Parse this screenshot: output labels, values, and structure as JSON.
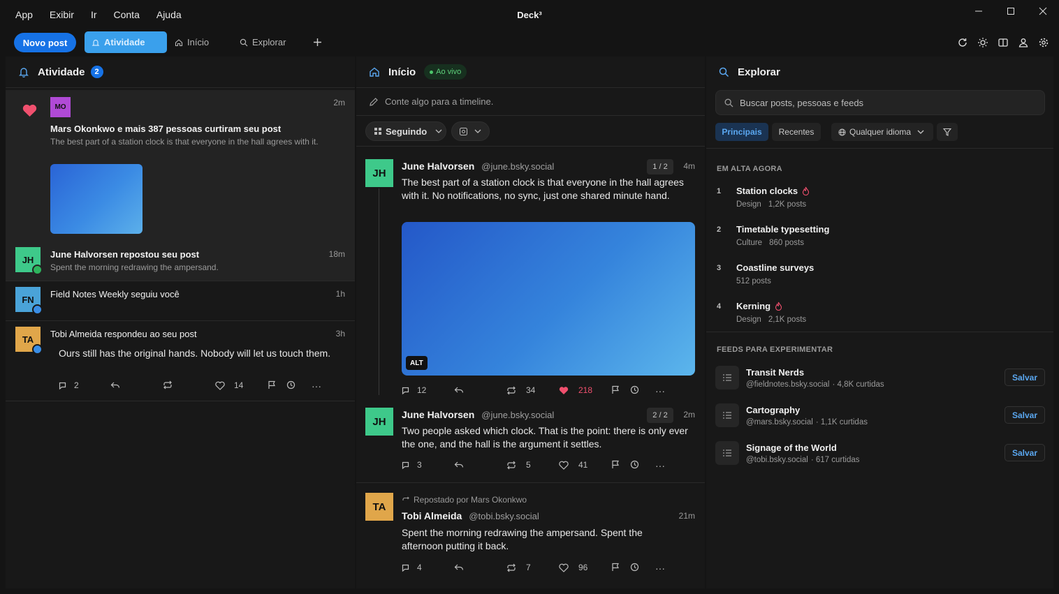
{
  "menu": [
    "App",
    "Exibir",
    "Ir",
    "Conta",
    "Ajuda"
  ],
  "window": {
    "title": "Deck³"
  },
  "toolbar": {
    "new_post": "Novo post",
    "tabs": {
      "activity": "Atividade",
      "home": "Início",
      "explore": "Explorar"
    }
  },
  "activity": {
    "title": "Atividade",
    "badge": "2",
    "items": [
      {
        "avatar": "MO",
        "avatar_color": "#b04ad6",
        "title": "Mars Okonkwo e mais 387 pessoas curtiram seu post",
        "snippet": "The best part of a station clock is that everyone in the hall agrees with it.",
        "time": "2m"
      },
      {
        "avatar": "JH",
        "avatar_color": "#3ec98a",
        "title": "June Halvorsen repostou seu post",
        "snippet": "Spent the morning redrawing the ampersand.",
        "time": "18m"
      },
      {
        "avatar": "FN",
        "avatar_color": "#4aa3d8",
        "title": "Field Notes Weekly seguiu você",
        "time": "1h"
      },
      {
        "avatar": "TA",
        "avatar_color": "#e0a64a",
        "title": "Tobi Almeida respondeu ao seu post",
        "reply": "Ours still has the original hands. Nobody will let us touch them.",
        "time": "3h",
        "replies": "2",
        "likes": "14"
      }
    ]
  },
  "home": {
    "title": "Início",
    "live": "Ao vivo",
    "composer_placeholder": "Conte algo para a timeline.",
    "feed_select": "Seguindo",
    "posts": [
      {
        "avatar": "JH",
        "avatar_color": "#3ec98a",
        "name": "June Halvorsen",
        "handle": "@june.bsky.social",
        "thread": "1 / 2",
        "time": "4m",
        "text": "The best part of a station clock is that everyone in the hall agrees with it. No notifications, no sync, just one shared minute hand.",
        "alt": "ALT",
        "replies": "12",
        "reposts": "34",
        "likes": "218"
      },
      {
        "avatar": "JH",
        "avatar_color": "#3ec98a",
        "name": "June Halvorsen",
        "handle": "@june.bsky.social",
        "thread": "2 / 2",
        "time": "2m",
        "text": "Two people asked which clock. That is the point: there is only ever the one, and the hall is the argument it settles.",
        "replies": "3",
        "reposts": "5",
        "likes": "41"
      },
      {
        "avatar": "TA",
        "avatar_color": "#e0a64a",
        "repost_by": "Repostado por Mars Okonkwo",
        "name": "Tobi Almeida",
        "handle": "@tobi.bsky.social",
        "time": "21m",
        "text": "Spent the morning redrawing the ampersand. Spent the afternoon putting it back.",
        "replies": "4",
        "reposts": "7",
        "likes": "96"
      }
    ]
  },
  "explore": {
    "title": "Explorar",
    "search_placeholder": "Buscar posts, pessoas e feeds",
    "filters": {
      "top": "Principais",
      "recent": "Recentes",
      "language": "Qualquer idioma"
    },
    "trending_title": "EM ALTA AGORA",
    "trending": [
      {
        "rank": "1",
        "name": "Station clocks",
        "category": "Design",
        "count": "1,2K posts",
        "hot": true
      },
      {
        "rank": "2",
        "name": "Timetable typesetting",
        "category": "Culture",
        "count": "860 posts",
        "hot": false
      },
      {
        "rank": "3",
        "name": "Coastline surveys",
        "category": "",
        "count": "512 posts",
        "hot": false
      },
      {
        "rank": "4",
        "name": "Kerning",
        "category": "Design",
        "count": "2,1K posts",
        "hot": true
      }
    ],
    "feeds_title": "FEEDS PARA EXPERIMENTAR",
    "feeds": [
      {
        "name": "Transit Nerds",
        "handle": "@fieldnotes.bsky.social",
        "likes": "· 4,8K curtidas",
        "save": "Salvar"
      },
      {
        "name": "Cartography",
        "handle": "@mars.bsky.social",
        "likes": "· 1,1K curtidas",
        "save": "Salvar"
      },
      {
        "name": "Signage of the World",
        "handle": "@tobi.bsky.social",
        "likes": "· 617 curtidas",
        "save": "Salvar"
      }
    ]
  },
  "colors": {
    "accent": "#1672e6",
    "active_tab": "#3aa0ec",
    "like": "#f0506e",
    "live": "#5ed17b"
  }
}
